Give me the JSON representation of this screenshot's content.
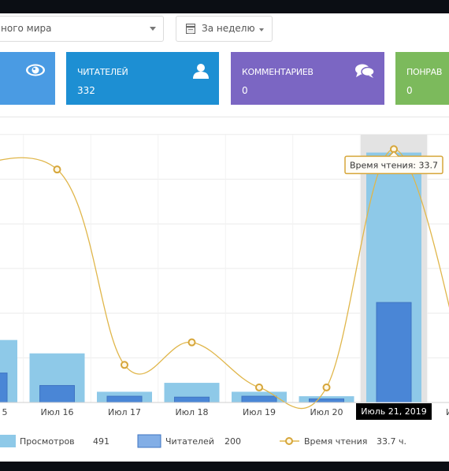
{
  "filters": {
    "source_select_value": "ного мира",
    "period_label": "За неделю"
  },
  "cards": [
    {
      "title": "",
      "value": "",
      "icon": "eye-icon",
      "color": "#4a9be3"
    },
    {
      "title": "ЧИТАТЕЛЕЙ",
      "value": "332",
      "icon": "user-icon",
      "color": "#1d8fd3"
    },
    {
      "title": "КОММЕНТАРИЕВ",
      "value": "0",
      "icon": "comments-icon",
      "color": "#7b66c3"
    },
    {
      "title": "ПОНРАВ",
      "value": "0",
      "icon": "",
      "color": "#7cba5c"
    }
  ],
  "chart_data": {
    "type": "bar",
    "categories": [
      "…5",
      "Июл 16",
      "Июл 17",
      "Июл 18",
      "Июл 19",
      "Июл 20",
      "Июль 21, 2019",
      "И…"
    ],
    "series": [
      {
        "name": "Просмотров",
        "kind": "bar",
        "color": "#8ec9e8",
        "values": [
          70,
          55,
          12,
          22,
          12,
          7,
          280,
          null
        ]
      },
      {
        "name": "Читателей",
        "kind": "bar",
        "color": "#4a86d6",
        "values": [
          33,
          19,
          7,
          6,
          7,
          4,
          112,
          null
        ]
      },
      {
        "name": "Время чтения",
        "kind": "line",
        "color": "#e0b64a",
        "values": [
          null,
          31,
          5,
          8,
          2,
          2,
          33.7,
          null
        ]
      }
    ],
    "ylim_bars": [
      0,
      300
    ],
    "ylim_line": [
      0,
      35
    ],
    "grid": true,
    "highlighted_category": "Июль 21, 2019",
    "tooltip": "Время чтения: 33.7",
    "legend": {
      "position": "bottom",
      "items": [
        {
          "label": "Просмотров",
          "value": "491"
        },
        {
          "label": "Читателей",
          "value": "200"
        },
        {
          "label": "Время чтения",
          "value": "33.7 ч."
        }
      ]
    }
  }
}
